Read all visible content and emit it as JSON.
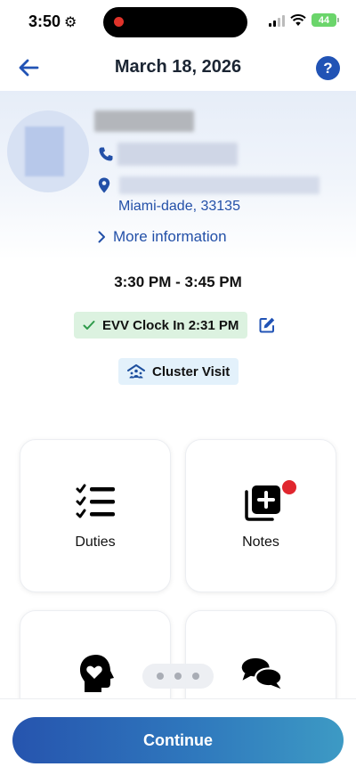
{
  "status_bar": {
    "time": "3:50",
    "battery": "44"
  },
  "header": {
    "title": "March 18, 2026",
    "help_label": "?"
  },
  "client": {
    "address_line": "Miami-dade, 33135",
    "more_info_label": "More information"
  },
  "visit": {
    "time_range": "3:30 PM - 3:45 PM",
    "evv_label": "EVV Clock In 2:31 PM",
    "cluster_label": "Cluster Visit"
  },
  "cards": [
    {
      "label": "Duties",
      "icon": "checklist-icon",
      "has_notification": false
    },
    {
      "label": "Notes",
      "icon": "notes-add-icon",
      "has_notification": true
    },
    {
      "label": "",
      "icon": "head-heart-icon",
      "has_notification": false
    },
    {
      "label": "",
      "icon": "chat-bubbles-icon",
      "has_notification": false
    }
  ],
  "pager": {
    "dots": 3
  },
  "footer": {
    "continue_label": "Continue"
  },
  "colors": {
    "accent": "#2153b5",
    "link": "#2350a8",
    "evv_bg": "#dcf2e0",
    "cluster_bg": "#e3f1fb",
    "notification": "#e0262e"
  }
}
